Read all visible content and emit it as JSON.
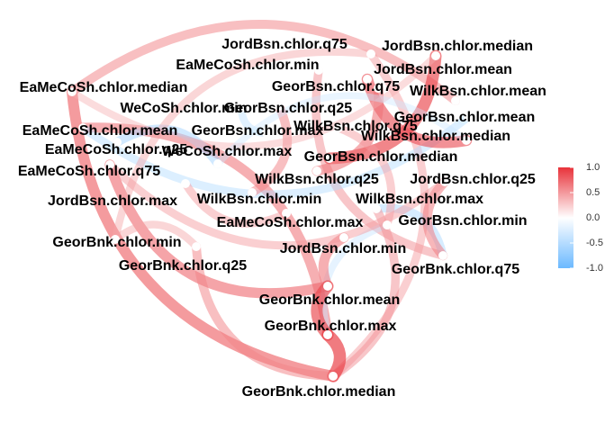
{
  "chart_data": {
    "type": "network",
    "nodes": [
      "JordBsn.chlor.q75",
      "JordBsn.chlor.median",
      "EaMeCoSh.chlor.min",
      "JordBsn.chlor.mean",
      "GeorBsn.chlor.q75",
      "WilkBsn.chlor.mean",
      "EaMeCoSh.chlor.median",
      "WeCoSh.chlor.min",
      "GeorBsn.chlor.q25",
      "GeorBsn.chlor.mean",
      "EaMeCoSh.chlor.mean",
      "GeorBsn.chlor.max",
      "WilkBsn.chlor.q75",
      "WilkBsn.chlor.median",
      "EaMeCoSh.chlor.q25",
      "WeCoSh.chlor.max",
      "GeorBsn.chlor.median",
      "EaMeCoSh.chlor.q75",
      "WilkBsn.chlor.q25",
      "JordBsn.chlor.q25",
      "JordBsn.chlor.max",
      "WilkBsn.chlor.min",
      "WilkBsn.chlor.max",
      "EaMeCoSh.chlor.max",
      "GeorBsn.chlor.min",
      "GeorBnk.chlor.min",
      "JordBsn.chlor.min",
      "GeorBnk.chlor.q25",
      "GeorBnk.chlor.q75",
      "GeorBnk.chlor.mean",
      "GeorBnk.chlor.max",
      "GeorBnk.chlor.median"
    ],
    "edges": [
      {
        "from": "EaMeCoSh.chlor.median",
        "to": "GeorBnk.chlor.median",
        "r": 0.8
      },
      {
        "from": "EaMeCoSh.chlor.mean",
        "to": "GeorBnk.chlor.max",
        "r": 0.7
      },
      {
        "from": "EaMeCoSh.chlor.q75",
        "to": "GeorBnk.chlor.mean",
        "r": 0.75
      },
      {
        "from": "EaMeCoSh.chlor.median",
        "to": "WilkBsn.chlor.mean",
        "r": 0.6
      },
      {
        "from": "EaMeCoSh.chlor.min",
        "to": "GeorBnk.chlor.q75",
        "r": 0.55
      },
      {
        "from": "JordBsn.chlor.q75",
        "to": "GeorBnk.chlor.median",
        "r": 0.5
      },
      {
        "from": "EaMeCoSh.chlor.mean",
        "to": "GeorBsn.chlor.mean",
        "r": -0.5
      },
      {
        "from": "EaMeCoSh.chlor.q25",
        "to": "WeCoSh.chlor.max",
        "r": -0.6
      },
      {
        "from": "WeCoSh.chlor.min",
        "to": "GeorBsn.chlor.max",
        "r": -0.45
      },
      {
        "from": "WilkBsn.chlor.max",
        "to": "GeorBnk.chlor.q75",
        "r": -0.55
      },
      {
        "from": "GeorBsn.chlor.min",
        "to": "GeorBnk.chlor.max",
        "r": -0.4
      },
      {
        "from": "JordBsn.chlor.median",
        "to": "GeorBsn.chlor.median",
        "r": 0.9
      },
      {
        "from": "JordBsn.chlor.mean",
        "to": "WilkBsn.chlor.median",
        "r": 0.85
      },
      {
        "from": "GeorBsn.chlor.q75",
        "to": "WilkBsn.chlor.q25",
        "r": 0.7
      },
      {
        "from": "JordBsn.chlor.q25",
        "to": "GeorBnk.chlor.q75",
        "r": 0.65
      },
      {
        "from": "GeorBsn.chlor.q25",
        "to": "WilkBsn.chlor.min",
        "r": 0.6
      },
      {
        "from": "JordBsn.chlor.max",
        "to": "EaMeCoSh.chlor.max",
        "r": 0.5
      },
      {
        "from": "WilkBsn.chlor.max",
        "to": "GeorBnk.chlor.median",
        "r": 0.55
      },
      {
        "from": "JordBsn.chlor.min",
        "to": "GeorBnk.chlor.mean",
        "r": 0.7
      },
      {
        "from": "GeorBnk.chlor.min",
        "to": "GeorBnk.chlor.q25",
        "r": 0.45
      },
      {
        "from": "GeorBnk.chlor.mean",
        "to": "GeorBnk.chlor.max",
        "r": 0.9
      },
      {
        "from": "GeorBnk.chlor.max",
        "to": "GeorBnk.chlor.median",
        "r": 0.95
      },
      {
        "from": "GeorBnk.chlor.q25",
        "to": "GeorBnk.chlor.median",
        "r": 0.6
      },
      {
        "from": "WilkBsn.chlor.q75",
        "to": "GeorBsn.chlor.min",
        "r": 0.5
      },
      {
        "from": "EaMeCoSh.chlor.median",
        "to": "JordBsn.chlor.median",
        "r": 0.4
      },
      {
        "from": "GeorBnk.chlor.min",
        "to": "JordBsn.chlor.q75",
        "r": 0.45
      },
      {
        "from": "EaMeCoSh.chlor.q75",
        "to": "JordBsn.chlor.q25",
        "r": 0.5
      },
      {
        "from": "WeCoSh.chlor.max",
        "to": "WilkBsn.chlor.median",
        "r": -0.35
      }
    ],
    "legend": {
      "ticks": [
        "1.0",
        "0.5",
        "0.0",
        "-0.5",
        "-1.0"
      ],
      "range": [
        -1.0,
        1.0
      ],
      "placement": "right",
      "colors": {
        "negative": "#6BB9FF",
        "zero": "#FFFFFF",
        "positive": "#E8323A"
      }
    }
  }
}
